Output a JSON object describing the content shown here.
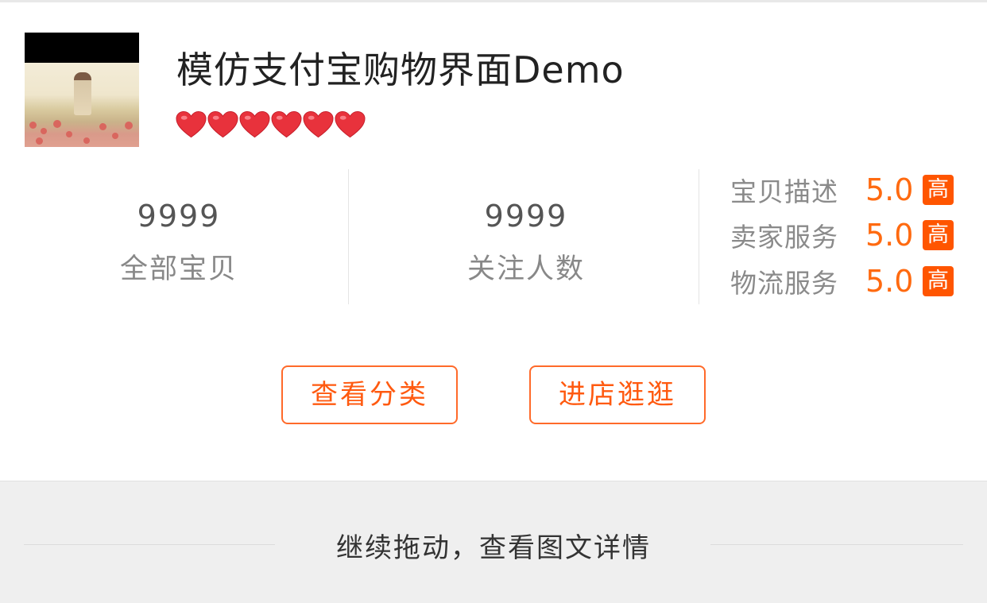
{
  "store": {
    "title": "模仿支付宝购物界面Demo",
    "hearts_count": 6
  },
  "stats": {
    "products": {
      "value": "9999",
      "label": "全部宝贝"
    },
    "followers": {
      "value": "9999",
      "label": "关注人数"
    }
  },
  "scores": [
    {
      "label": "宝贝描述",
      "value": "5.0",
      "badge": "高"
    },
    {
      "label": "卖家服务",
      "value": "5.0",
      "badge": "高"
    },
    {
      "label": "物流服务",
      "value": "5.0",
      "badge": "高"
    }
  ],
  "actions": {
    "category_label": "查看分类",
    "store_label": "进店逛逛"
  },
  "drag_hint": "继续拖动，查看图文详情",
  "colors": {
    "accent": "#ff5500",
    "heart": "#e8323c"
  },
  "icons": {
    "heart": "heart-icon"
  }
}
